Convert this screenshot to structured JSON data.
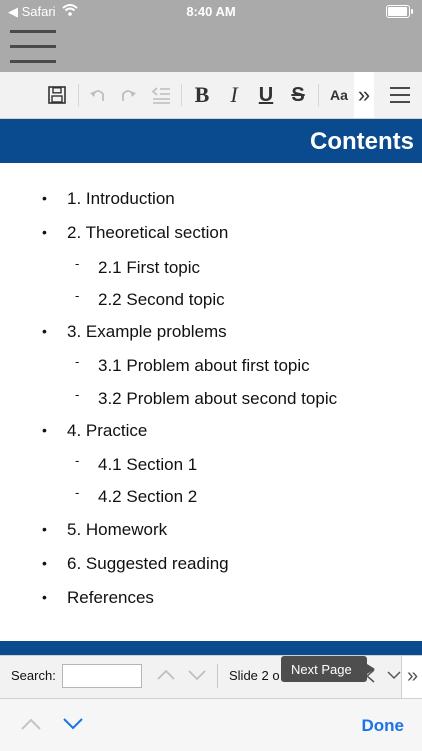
{
  "status_bar": {
    "back_app": "Safari",
    "time": "8:40 AM"
  },
  "slide": {
    "title": "Contents",
    "items": [
      {
        "text": "1. Introduction",
        "level": 1
      },
      {
        "text": "2. Theoretical section",
        "level": 1
      },
      {
        "text": "2.1 First topic",
        "level": 2
      },
      {
        "text": "2.2 Second topic",
        "level": 2
      },
      {
        "text": "3. Example problems",
        "level": 1
      },
      {
        "text": "3.1 Problem about first topic",
        "level": 2
      },
      {
        "text": "3.2 Problem about second topic",
        "level": 2
      },
      {
        "text": "4. Practice",
        "level": 1
      },
      {
        "text": "4.1 Section 1",
        "level": 2
      },
      {
        "text": "4.2 Section 2",
        "level": 2
      },
      {
        "text": "5. Homework",
        "level": 1
      },
      {
        "text": "6. Suggested reading",
        "level": 1
      },
      {
        "text": "References",
        "level": 1
      }
    ],
    "bullet_symbol": "•",
    "sub_bullet_symbol": "-"
  },
  "toolbar": {
    "font_size_label": "Aa",
    "more_label": "»"
  },
  "navbar": {
    "search_label": "Search:",
    "search_value": "",
    "slide_indicator": "Slide 2 o",
    "tooltip": "Next Page",
    "more_label": "»"
  },
  "bottom_bar": {
    "done_label": "Done"
  },
  "colors": {
    "header_blue": "#0a4a8e",
    "link_blue": "#1a73e8",
    "gray_bar": "#aaaaaa"
  }
}
